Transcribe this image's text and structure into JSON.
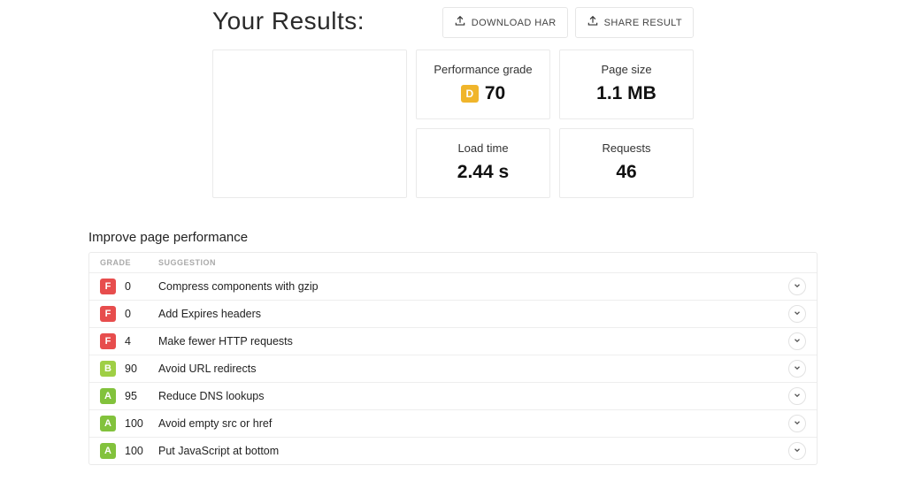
{
  "header": {
    "title": "Your Results:",
    "download_label": "DOWNLOAD HAR",
    "share_label": "SHARE RESULT"
  },
  "metrics": {
    "performance": {
      "label": "Performance grade",
      "grade": "D",
      "value": "70"
    },
    "pagesize": {
      "label": "Page size",
      "value": "1.1 MB"
    },
    "loadtime": {
      "label": "Load time",
      "value": "2.44 s"
    },
    "requests": {
      "label": "Requests",
      "value": "46"
    }
  },
  "improve": {
    "title": "Improve page performance",
    "head_grade": "GRADE",
    "head_suggestion": "SUGGESTION",
    "rows": [
      {
        "grade": "F",
        "score": "0",
        "text": "Compress components with gzip"
      },
      {
        "grade": "F",
        "score": "0",
        "text": "Add Expires headers"
      },
      {
        "grade": "F",
        "score": "4",
        "text": "Make fewer HTTP requests"
      },
      {
        "grade": "B",
        "score": "90",
        "text": "Avoid URL redirects"
      },
      {
        "grade": "A",
        "score": "95",
        "text": "Reduce DNS lookups"
      },
      {
        "grade": "A",
        "score": "100",
        "text": "Avoid empty src or href"
      },
      {
        "grade": "A",
        "score": "100",
        "text": "Put JavaScript at bottom"
      }
    ]
  }
}
